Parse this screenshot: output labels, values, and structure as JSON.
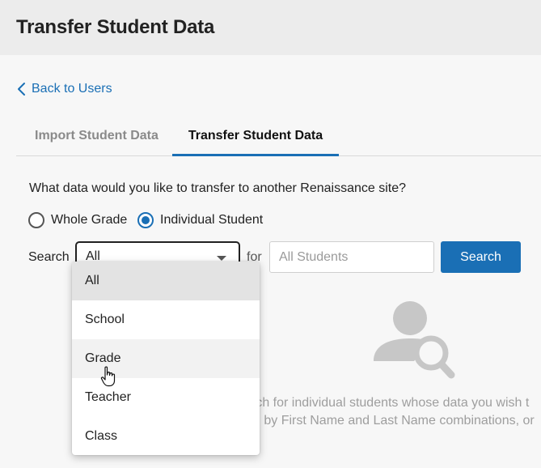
{
  "header": {
    "title": "Transfer Student Data"
  },
  "nav": {
    "back_label": "Back to Users"
  },
  "tabs": [
    {
      "label": "Import Student Data",
      "active": false
    },
    {
      "label": "Transfer Student Data",
      "active": true
    }
  ],
  "form": {
    "question": "What data would you like to transfer to another Renaissance site?",
    "radios": [
      {
        "label": "Whole Grade",
        "checked": false
      },
      {
        "label": "Individual Student",
        "checked": true
      }
    ],
    "search_label": "Search",
    "filter_value": "All",
    "for_label": "for",
    "students_placeholder": "All Students",
    "search_button": "Search"
  },
  "dropdown": {
    "options": [
      "All",
      "School",
      "Grade",
      "Teacher",
      "Class"
    ],
    "selected": "All",
    "hovered": "Grade"
  },
  "empty_state": {
    "icon": "user-search-icon",
    "line1": "rch for individual students whose data you wish t",
    "line2": "h by First Name and Last Name combinations, or"
  },
  "colors": {
    "accent": "#1a6fb5",
    "header_bg": "#ececec",
    "page_bg": "#f7f7f7"
  }
}
